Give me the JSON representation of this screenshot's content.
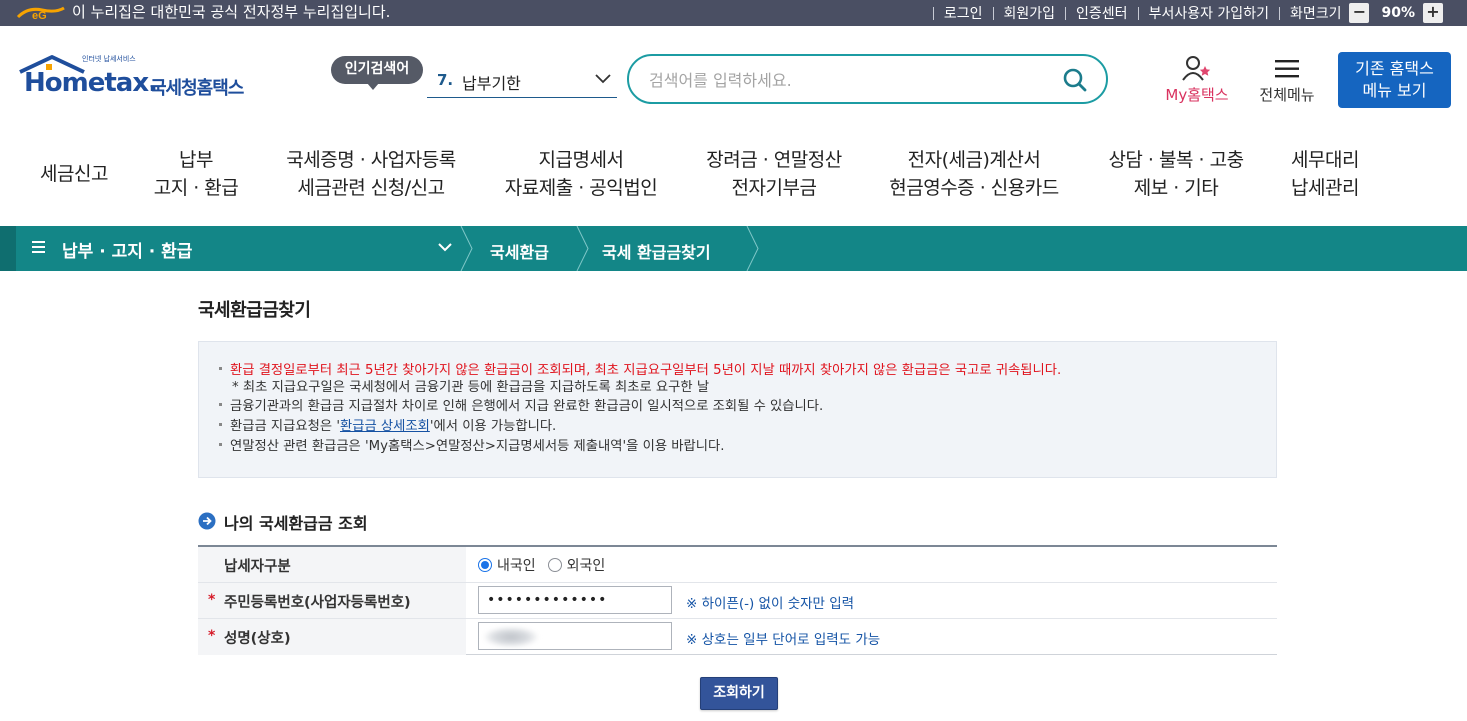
{
  "gov_bar": {
    "text": "이 누리집은 대한민국 공식 전자정부 누리집입니다.",
    "links": [
      "로그인",
      "회원가입",
      "인증센터",
      "부서사용자 가입하기",
      "화면크기"
    ],
    "zoom_minus": "−",
    "zoom_value": "90%",
    "zoom_plus": "+"
  },
  "header": {
    "logo_main": "Hometax.",
    "logo_sub": "인터넷 납세서비스",
    "logo_kr": "국세청홈택스",
    "popular_badge": "인기검색어",
    "popular_rank": "7.",
    "popular_word": "납부기한",
    "search_placeholder": "검색어를 입력하세요.",
    "search_value": "",
    "myhome_label": "My홈택스",
    "allmenu_label": "전체메뉴",
    "old_home_line1": "기존 홈택스",
    "old_home_line2": "메뉴 보기"
  },
  "gnb": [
    {
      "line1": "세금신고",
      "line2": ""
    },
    {
      "line1": "납부",
      "line2": "고지 · 환급"
    },
    {
      "line1": "국세증명 · 사업자등록",
      "line2": "세금관련 신청/신고"
    },
    {
      "line1": "지급명세서",
      "line2": "자료제출 · 공익법인"
    },
    {
      "line1": "장려금 · 연말정산",
      "line2": "전자기부금"
    },
    {
      "line1": "전자(세금)계산서",
      "line2": "현금영수증 · 신용카드"
    },
    {
      "line1": "상담 · 불복 · 고충",
      "line2": "제보 · 기타"
    },
    {
      "line1": "세무대리",
      "line2": "납세관리"
    }
  ],
  "location": {
    "main": "납부 · 고지 · 환급",
    "crumb1": "국세환급",
    "crumb2": "국세 환급금찾기"
  },
  "page": {
    "title": "국세환급금찾기",
    "notice": {
      "line1": "환급 결정일로부터 최근 5년간 찾아가지 않은 환급금이 조회되며, 최초 지급요구일부터 5년이 지날 때까지 찾아가지 않은 환급금은 국고로 귀속됩니다.",
      "line1_sub": "* 최초 지급요구일은 국세청에서 금융기관 등에 환급금을 지급하도록 최초로 요구한 날",
      "line2": "금융기관과의 환급금 지급절차 차이로 인해 은행에서 지급 완료한 환급금이 일시적으로 조회될 수 있습니다.",
      "line3_pre": "환급금 지급요청은 '",
      "line3_link": "환급금 상세조회",
      "line3_post": "'에서 이용 가능합니다.",
      "line4": "연말정산 관련 환급금은 'My홈택스>연말정산>지급명세서등 제출내역'을 이용 바랍니다."
    },
    "section_title": "나의 국세환급금 조회",
    "form": {
      "row1_label": "납세자구분",
      "radio_domestic": "내국인",
      "radio_foreign": "외국인",
      "selected": "내국인",
      "row2_star": "*",
      "row2_label": "주민등록번호(사업자등록번호)",
      "row2_value": "•••••••••••••",
      "row2_hint": "※ 하이픈(-) 없이 숫자만 입력",
      "row3_star": "*",
      "row3_label": "성명(상호)",
      "row3_hint": "※ 상호는 일부 단어로 입력도 가능"
    },
    "submit_label": "조회하기"
  },
  "colors": {
    "gov_bar": "#4a4f63",
    "brand_blue": "#1f4e9c",
    "teal": "#138687",
    "search_border": "#1c9ca3",
    "notice_red": "#e0141e",
    "link_blue": "#1652a3",
    "submit": "#33549a"
  }
}
